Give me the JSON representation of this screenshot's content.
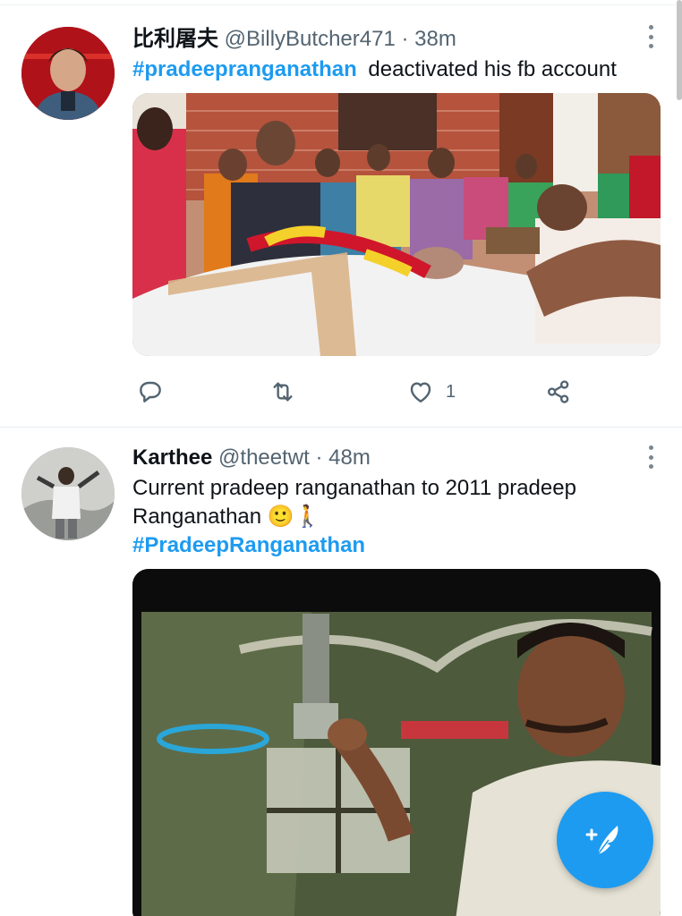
{
  "tweets": [
    {
      "display_name": "比利屠夫",
      "handle": "@BillyButcher471",
      "separator": "·",
      "time": "38m",
      "hashtag": "#pradeepranganathan",
      "text": "deactivated his fb account",
      "media_alt": "Photo of a funeral scene with mourners seated around a body draped with a white cloth and flower garlands",
      "actions": {
        "reply_icon": "reply-icon",
        "retweet_icon": "retweet-icon",
        "like_icon": "heart-icon",
        "like_count": "1",
        "share_icon": "share-icon"
      }
    },
    {
      "display_name": "Karthee",
      "handle": "@theetwt",
      "separator": "·",
      "time": "48m",
      "text_line1": "Current pradeep ranganathan to 2011 pradeep",
      "text_line2": "Ranganathan",
      "emoji": "🙂🚶",
      "hashtag": "#PradeepRanganathan",
      "media_alt": "Video still of a man smiling while holding a bottle in a dim interior"
    }
  ],
  "fab_icon": "compose-tweet-icon",
  "colors": {
    "accent": "#1d9bf0",
    "text": "#0f1419",
    "secondary": "#536471"
  }
}
